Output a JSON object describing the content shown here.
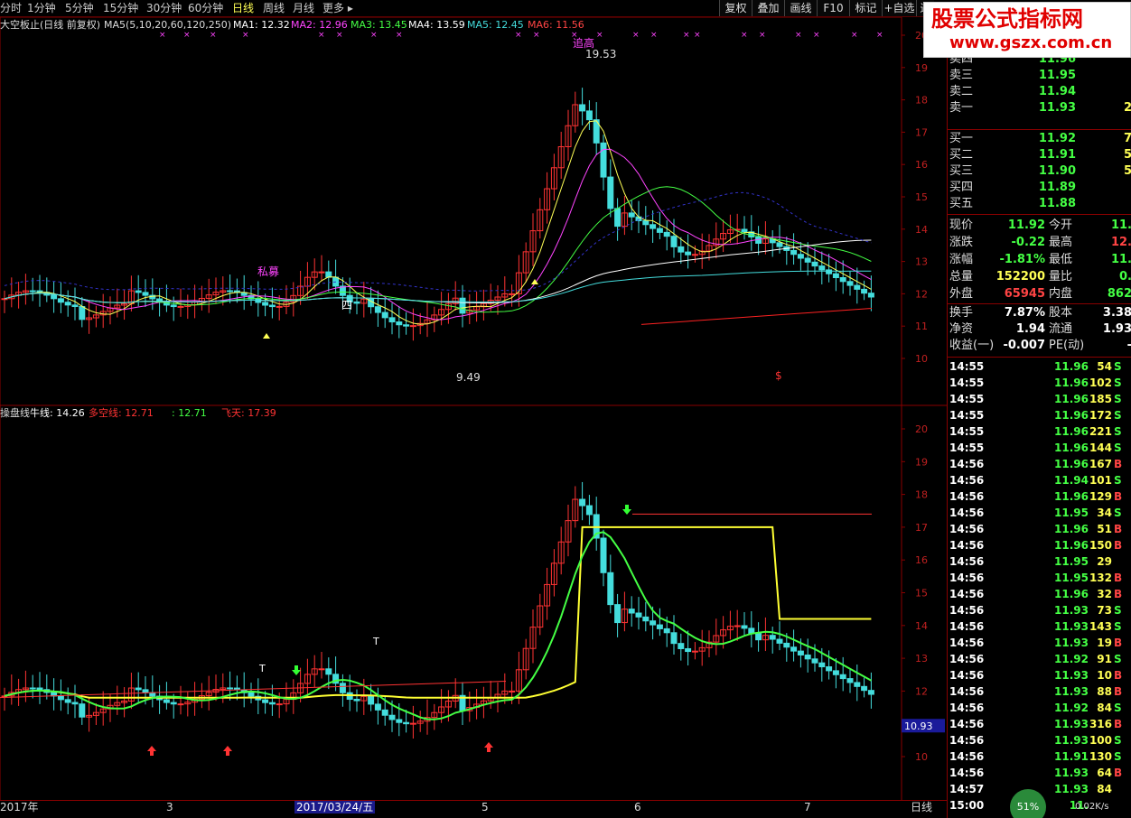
{
  "toolbar": {
    "timeframes": [
      {
        "label": "分时",
        "active": false
      },
      {
        "label": "1分钟",
        "active": false
      },
      {
        "label": "5分钟",
        "active": false
      },
      {
        "label": "15分钟",
        "active": false
      },
      {
        "label": "30分钟",
        "active": false
      },
      {
        "label": "60分钟",
        "active": false
      },
      {
        "label": "日线",
        "active": true
      },
      {
        "label": "周线",
        "active": false
      },
      {
        "label": "月线",
        "active": false
      },
      {
        "label": "更多 ▸",
        "active": false
      }
    ],
    "buttons": [
      "复权",
      "叠加",
      "画线",
      "F10",
      "标记",
      "+自选",
      "返"
    ]
  },
  "watermark": {
    "title": "股票公式指标网",
    "url": "www.gszx.com.cn"
  },
  "main_legend": {
    "name": "大空板止(日线 前复权)",
    "ma_params": "MA5(5,10,20,60,120,250)",
    "items": [
      {
        "label": "MA1: 12.32",
        "color": "#ffffff"
      },
      {
        "label": "MA2: 12.96",
        "color": "#ff44ff"
      },
      {
        "label": "MA3: 13.45",
        "color": "#44ff44"
      },
      {
        "label": "MA4: 13.59",
        "color": "#ffffff"
      },
      {
        "label": "MA5: 12.45",
        "color": "#44dddd"
      },
      {
        "label": "MA6: 11.56",
        "color": "#ff4444"
      }
    ]
  },
  "sub_legend": {
    "name": "操盘线",
    "items": [
      {
        "label": "牛线: 14.26",
        "color": "#ffffff"
      },
      {
        "label": "多空线: 12.71",
        "color": "#ff3333"
      },
      {
        "label": ": 12.71",
        "color": "#44ff44"
      },
      {
        "label": "飞天: 17.39",
        "color": "#ff3333"
      }
    ]
  },
  "chart_data": [
    {
      "type": "candlestick",
      "panel": "main",
      "y_ticks": [
        20.0,
        19.0,
        18.0,
        17.0,
        16.0,
        15.0,
        14.0,
        13.0,
        12.0,
        11.0,
        10.0
      ],
      "annotations": [
        {
          "text": "追高",
          "color": "#ff44ff"
        },
        {
          "text": "19.53",
          "color": "#dddddd"
        },
        {
          "text": "9.49",
          "color": "#dddddd"
        },
        {
          "text": "私募",
          "color": "#ff44ff"
        },
        {
          "text": "四",
          "color": "#ffffff"
        },
        {
          "text": "$",
          "color": "#ff3333"
        }
      ]
    },
    {
      "type": "candlestick",
      "panel": "sub",
      "y_ticks": [
        20.0,
        19.0,
        18.0,
        17.0,
        16.0,
        15.0,
        14.0,
        13.0,
        12.0,
        11.0,
        10.0
      ],
      "current_value": "10.93",
      "annotations": [
        {
          "text": "T",
          "color": "#ffffff"
        },
        {
          "text": "T",
          "color": "#ffffff"
        }
      ]
    }
  ],
  "date_axis": {
    "labels": [
      "2017年",
      "3",
      "2017/03/24/五",
      "5",
      "6",
      "7"
    ],
    "period_label": "日线"
  },
  "quote": {
    "sells": [
      {
        "label": "卖五",
        "price": "",
        "vol": ""
      },
      {
        "label": "卖四",
        "price": "11.96",
        "vol": ""
      },
      {
        "label": "卖三",
        "price": "11.95",
        "vol": ""
      },
      {
        "label": "卖二",
        "price": "11.94",
        "vol": ""
      },
      {
        "label": "卖一",
        "price": "11.93",
        "vol": "2"
      }
    ],
    "buys": [
      {
        "label": "买一",
        "price": "11.92",
        "vol": "7"
      },
      {
        "label": "买二",
        "price": "11.91",
        "vol": "5"
      },
      {
        "label": "买三",
        "price": "11.90",
        "vol": "5"
      },
      {
        "label": "买四",
        "price": "11.89",
        "vol": ""
      },
      {
        "label": "买五",
        "price": "11.88",
        "vol": ""
      }
    ],
    "stats": [
      {
        "l1": "现价",
        "v1": "11.92",
        "c1": "#44ff44",
        "l2": "今开",
        "v2": "11.",
        "c2": "#44ff44"
      },
      {
        "l1": "涨跌",
        "v1": "-0.22",
        "c1": "#44ff44",
        "l2": "最高",
        "v2": "12.",
        "c2": "#ff4444"
      },
      {
        "l1": "涨幅",
        "v1": "-1.81%",
        "c1": "#44ff44",
        "l2": "最低",
        "v2": "11.",
        "c2": "#44ff44"
      },
      {
        "l1": "总量",
        "v1": "152200",
        "c1": "#ffff55",
        "l2": "量比",
        "v2": "0.",
        "c2": "#44ff44"
      },
      {
        "l1": "外盘",
        "v1": "65945",
        "c1": "#ff4444",
        "l2": "内盘",
        "v2": "862",
        "c2": "#44ff44"
      }
    ],
    "stats2": [
      {
        "l1": "换手",
        "v1": "7.87%",
        "c1": "#ffffff",
        "l2": "股本",
        "v2": "3.38",
        "c2": "#ffffff"
      },
      {
        "l1": "净资",
        "v1": "1.94",
        "c1": "#ffffff",
        "l2": "流通",
        "v2": "1.93",
        "c2": "#ffffff"
      },
      {
        "l1": "收益(一)",
        "v1": "-0.007",
        "c1": "#ffffff",
        "l2": "PE(动)",
        "v2": "-",
        "c2": "#ffffff"
      }
    ]
  },
  "ticks": [
    {
      "time": "14:55",
      "price": "11.96",
      "vol": "54",
      "side": "S"
    },
    {
      "time": "14:55",
      "price": "11.96",
      "vol": "102",
      "side": "S"
    },
    {
      "time": "14:55",
      "price": "11.96",
      "vol": "185",
      "side": "S"
    },
    {
      "time": "14:55",
      "price": "11.96",
      "vol": "172",
      "side": "S"
    },
    {
      "time": "14:55",
      "price": "11.96",
      "vol": "221",
      "side": "S"
    },
    {
      "time": "14:55",
      "price": "11.96",
      "vol": "144",
      "side": "S"
    },
    {
      "time": "14:56",
      "price": "11.96",
      "vol": "167",
      "side": "B"
    },
    {
      "time": "14:56",
      "price": "11.94",
      "vol": "101",
      "side": "S"
    },
    {
      "time": "14:56",
      "price": "11.96",
      "vol": "129",
      "side": "B"
    },
    {
      "time": "14:56",
      "price": "11.95",
      "vol": "34",
      "side": "S"
    },
    {
      "time": "14:56",
      "price": "11.96",
      "vol": "51",
      "side": "B"
    },
    {
      "time": "14:56",
      "price": "11.96",
      "vol": "150",
      "side": "B"
    },
    {
      "time": "14:56",
      "price": "11.95",
      "vol": "29",
      "side": ""
    },
    {
      "time": "14:56",
      "price": "11.95",
      "vol": "132",
      "side": "B"
    },
    {
      "time": "14:56",
      "price": "11.96",
      "vol": "32",
      "side": "B"
    },
    {
      "time": "14:56",
      "price": "11.93",
      "vol": "73",
      "side": "S"
    },
    {
      "time": "14:56",
      "price": "11.93",
      "vol": "143",
      "side": "S"
    },
    {
      "time": "14:56",
      "price": "11.93",
      "vol": "19",
      "side": "B"
    },
    {
      "time": "14:56",
      "price": "11.92",
      "vol": "91",
      "side": "S"
    },
    {
      "time": "14:56",
      "price": "11.93",
      "vol": "10",
      "side": "B"
    },
    {
      "time": "14:56",
      "price": "11.93",
      "vol": "88",
      "side": "B"
    },
    {
      "time": "14:56",
      "price": "11.92",
      "vol": "84",
      "side": "S"
    },
    {
      "time": "14:56",
      "price": "11.93",
      "vol": "316",
      "side": "B"
    },
    {
      "time": "14:56",
      "price": "11.93",
      "vol": "100",
      "side": "S"
    },
    {
      "time": "14:56",
      "price": "11.91",
      "vol": "130",
      "side": "S"
    },
    {
      "time": "14:56",
      "price": "11.93",
      "vol": "64",
      "side": "B"
    },
    {
      "time": "14:57",
      "price": "11.93",
      "vol": "84",
      "side": ""
    },
    {
      "time": "15:00",
      "price": "11.",
      "vol": "",
      "side": ""
    }
  ],
  "status": {
    "cpu": "51%",
    "speed": "0.02K/s"
  }
}
